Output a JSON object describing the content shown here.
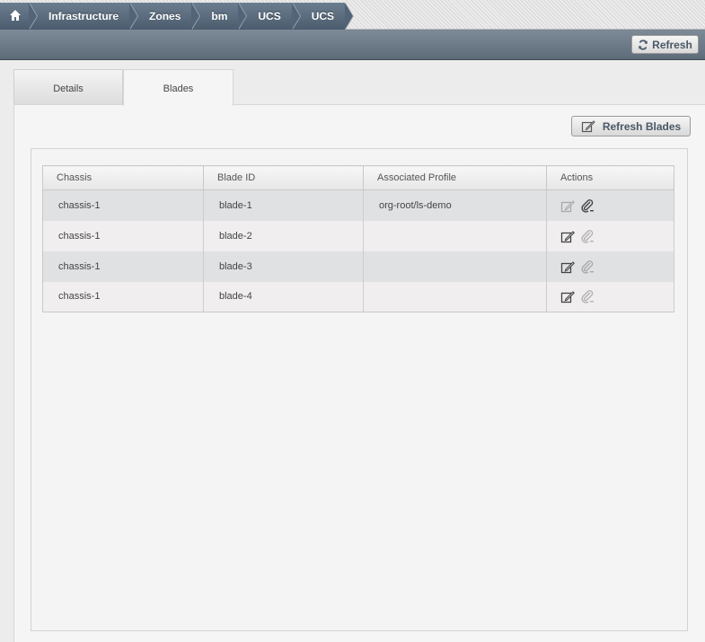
{
  "breadcrumb": {
    "home_icon": "home-icon",
    "items": [
      "Infrastructure",
      "Zones",
      "bm",
      "UCS",
      "UCS"
    ]
  },
  "toolbar": {
    "refresh_label": "Refresh",
    "refresh_icon": "refresh-icon"
  },
  "tabs": [
    {
      "label": "Details",
      "active": false
    },
    {
      "label": "Blades",
      "active": true
    }
  ],
  "refresh_blades_label": "Refresh Blades",
  "table": {
    "columns": [
      "Chassis",
      "Blade ID",
      "Associated Profile",
      "Actions"
    ],
    "rows": [
      {
        "chassis": "chassis-1",
        "blade_id": "blade-1",
        "profile": "org-root/ls-demo",
        "associate_enabled": false,
        "disassociate_enabled": true
      },
      {
        "chassis": "chassis-1",
        "blade_id": "blade-2",
        "profile": "",
        "associate_enabled": true,
        "disassociate_enabled": false
      },
      {
        "chassis": "chassis-1",
        "blade_id": "blade-3",
        "profile": "",
        "associate_enabled": true,
        "disassociate_enabled": false
      },
      {
        "chassis": "chassis-1",
        "blade_id": "blade-4",
        "profile": "",
        "associate_enabled": true,
        "disassociate_enabled": false
      }
    ]
  },
  "colors": {
    "crumb": "#56677a",
    "toolbar": "#6c7986",
    "row_alt": "#dfe1e3"
  }
}
